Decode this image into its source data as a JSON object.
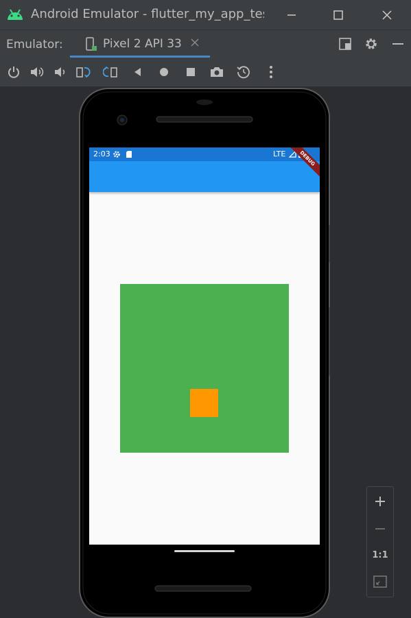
{
  "window": {
    "title": "Android Emulator - flutter_my_app_test",
    "minimize": "minimize-icon",
    "maximize": "maximize-icon",
    "close": "close-icon"
  },
  "tabbar": {
    "label": "Emulator:",
    "device_tab": "Pixel 2 API 33",
    "accent": "#4a88c7"
  },
  "toolbar": {
    "items": [
      "power-icon",
      "volume-up-icon",
      "volume-down-icon",
      "rotate-left-icon",
      "rotate-right-icon",
      "back-icon",
      "home-icon",
      "overview-icon",
      "screenshot-icon",
      "snapshot-icon",
      "more-icon"
    ]
  },
  "device": {
    "status_time": "2:03",
    "status_network": "LTE",
    "debug_banner": "DEBUG",
    "app_bar_color": "#2196f3",
    "outer_box_color": "#4caf50",
    "inner_box_color": "#ff9800"
  },
  "zoom": {
    "in": "zoom-in-icon",
    "out": "zoom-out-icon",
    "ratio": "1:1",
    "fit": "fit-screen-icon"
  }
}
